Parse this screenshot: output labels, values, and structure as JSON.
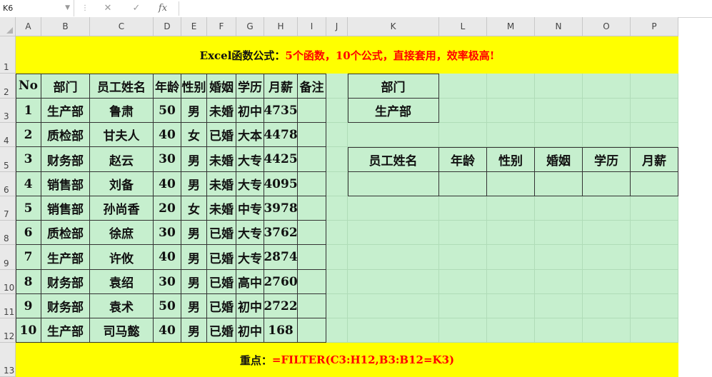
{
  "formula_bar": {
    "name_box": "K6",
    "cancel_icon": "✕",
    "enter_icon": "✓",
    "fx_label": "fx"
  },
  "columns": [
    "A",
    "B",
    "C",
    "D",
    "E",
    "F",
    "G",
    "H",
    "I",
    "J",
    "K",
    "L",
    "M",
    "N",
    "O",
    "P"
  ],
  "rows": [
    "1",
    "2",
    "3",
    "4",
    "5",
    "6",
    "7",
    "8",
    "9",
    "10",
    "11",
    "12",
    "13"
  ],
  "title": {
    "black": "Excel函数公式：",
    "red": "5个函数，10个公式，直接套用，效率极高!"
  },
  "main_table": {
    "headers": [
      "No",
      "部门",
      "员工姓名",
      "年龄",
      "性别",
      "婚姻",
      "学历",
      "月薪",
      "备注"
    ],
    "rows": [
      [
        "1",
        "生产部",
        "鲁肃",
        "50",
        "男",
        "未婚",
        "初中",
        "4735",
        ""
      ],
      [
        "2",
        "质检部",
        "甘夫人",
        "40",
        "女",
        "已婚",
        "大本",
        "4478",
        ""
      ],
      [
        "3",
        "财务部",
        "赵云",
        "30",
        "男",
        "未婚",
        "大专",
        "4425",
        ""
      ],
      [
        "4",
        "销售部",
        "刘备",
        "40",
        "男",
        "未婚",
        "大专",
        "4095",
        ""
      ],
      [
        "5",
        "销售部",
        "孙尚香",
        "20",
        "女",
        "未婚",
        "中专",
        "3978",
        ""
      ],
      [
        "6",
        "质检部",
        "徐庶",
        "30",
        "男",
        "已婚",
        "大专",
        "3762",
        ""
      ],
      [
        "7",
        "生产部",
        "许攸",
        "40",
        "男",
        "已婚",
        "大专",
        "2874",
        ""
      ],
      [
        "8",
        "财务部",
        "袁绍",
        "30",
        "男",
        "已婚",
        "高中",
        "2760",
        ""
      ],
      [
        "9",
        "财务部",
        "袁术",
        "50",
        "男",
        "已婚",
        "初中",
        "2722",
        ""
      ],
      [
        "10",
        "生产部",
        "司马懿",
        "40",
        "男",
        "已婚",
        "初中",
        "168",
        ""
      ]
    ]
  },
  "lookup": {
    "label": "部门",
    "value": "生产部"
  },
  "result_table": {
    "headers": [
      "员工姓名",
      "年龄",
      "性别",
      "婚姻",
      "学历",
      "月薪"
    ]
  },
  "footer": {
    "black": "重点：",
    "red": "=FILTER(C3:H12,B3:B12=K3)"
  },
  "colors": {
    "sheet_fill": "#c6efce",
    "banner": "#ffff00",
    "accent": "#ff0000"
  }
}
